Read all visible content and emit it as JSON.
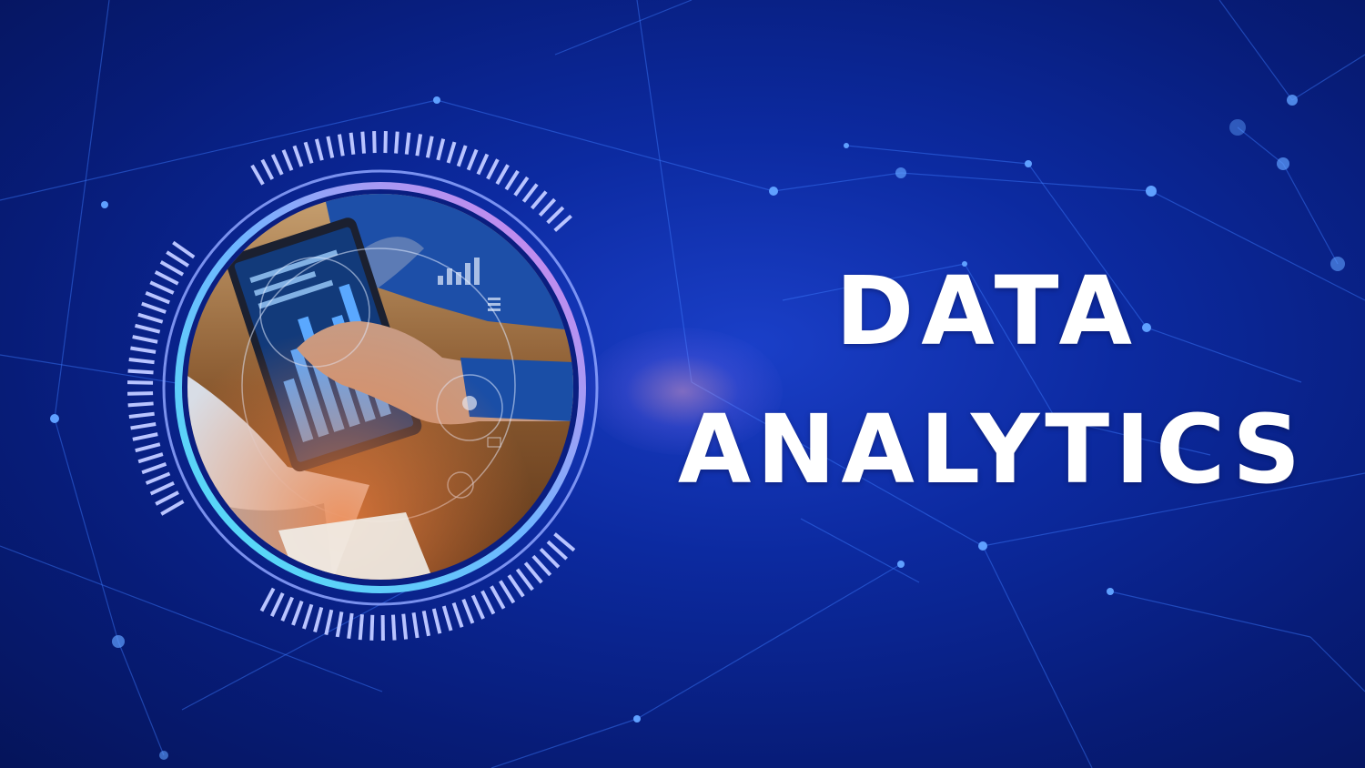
{
  "title": {
    "line1": "DATA",
    "line2": "ANALYTICS"
  },
  "colors": {
    "background": "#0c2aa0",
    "text": "#ffffff",
    "ring_gradient_start": "#4fe3f5",
    "ring_gradient_end": "#e07ce8",
    "tick_marks": "#b9c4ff"
  },
  "photo_subject": "hands-on-tablet-with-charts"
}
